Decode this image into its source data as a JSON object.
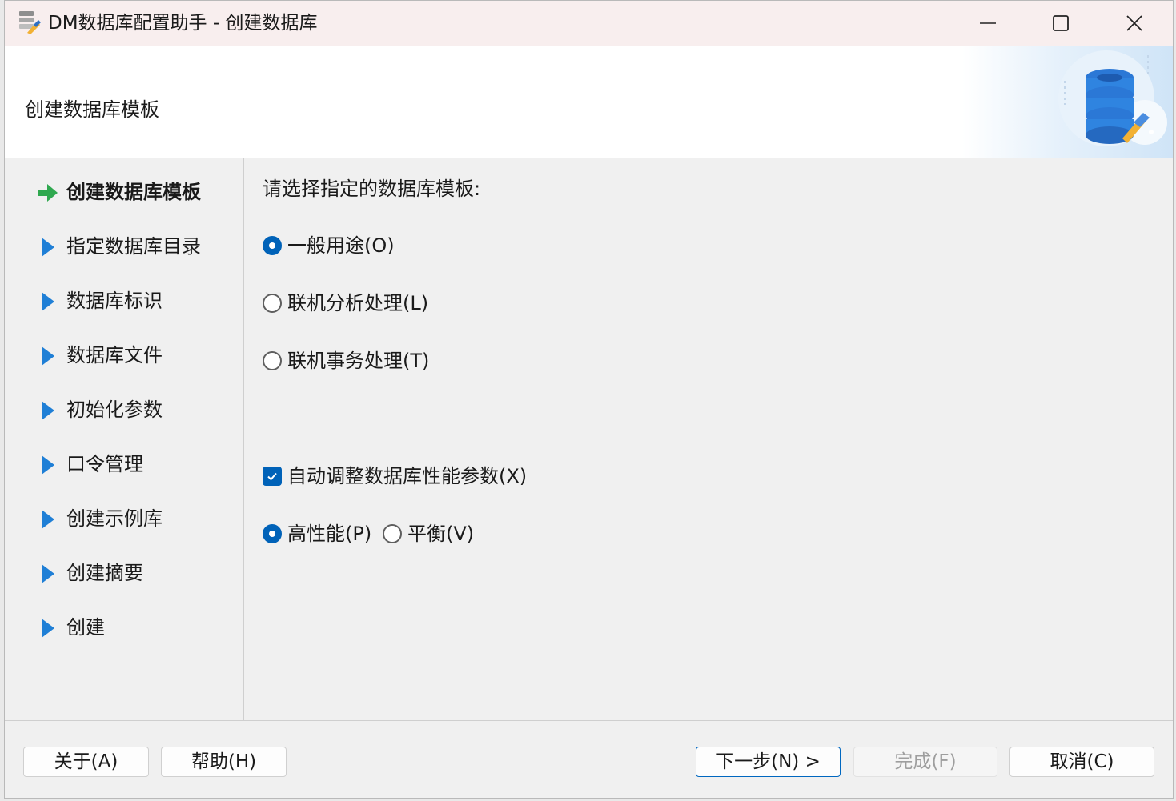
{
  "window": {
    "title": "DM数据库配置助手 - 创建数据库",
    "minimize_icon": "minimize-icon",
    "maximize_icon": "maximize-icon",
    "close_icon": "close-icon"
  },
  "header": {
    "title": "创建数据库模板",
    "logo_icon": "database-tools-icon"
  },
  "nav": {
    "items": [
      {
        "label": "创建数据库模板",
        "state": "current",
        "icon": "green-arrow-icon"
      },
      {
        "label": "指定数据库目录",
        "state": "pending",
        "icon": "blue-triangle-icon"
      },
      {
        "label": "数据库标识",
        "state": "pending",
        "icon": "blue-triangle-icon"
      },
      {
        "label": "数据库文件",
        "state": "pending",
        "icon": "blue-triangle-icon"
      },
      {
        "label": "初始化参数",
        "state": "pending",
        "icon": "blue-triangle-icon"
      },
      {
        "label": "口令管理",
        "state": "pending",
        "icon": "blue-triangle-icon"
      },
      {
        "label": "创建示例库",
        "state": "pending",
        "icon": "blue-triangle-icon"
      },
      {
        "label": "创建摘要",
        "state": "pending",
        "icon": "blue-triangle-icon"
      },
      {
        "label": "创建",
        "state": "pending",
        "icon": "blue-triangle-icon"
      }
    ]
  },
  "content": {
    "prompt": "请选择指定的数据库模板:",
    "templates": [
      {
        "label": "一般用途(O)",
        "checked": true
      },
      {
        "label": "联机分析处理(L)",
        "checked": false
      },
      {
        "label": "联机事务处理(T)",
        "checked": false
      }
    ],
    "auto_tune": {
      "label": "自动调整数据库性能参数(X)",
      "checked": true
    },
    "performance_modes": [
      {
        "label": "高性能(P)",
        "checked": true
      },
      {
        "label": "平衡(V)",
        "checked": false
      }
    ]
  },
  "footer": {
    "about_label": "关于(A)",
    "help_label": "帮助(H)",
    "next_label": "下一步(N) >",
    "finish_label": "完成(F)",
    "finish_enabled": false,
    "cancel_label": "取消(C)"
  },
  "colors": {
    "accent": "#0062b8",
    "current_arrow": "#2fa84f",
    "pending_triangle": "#1f7fd6",
    "titlebar": "#f8eeee",
    "background": "#f0f0f0"
  }
}
